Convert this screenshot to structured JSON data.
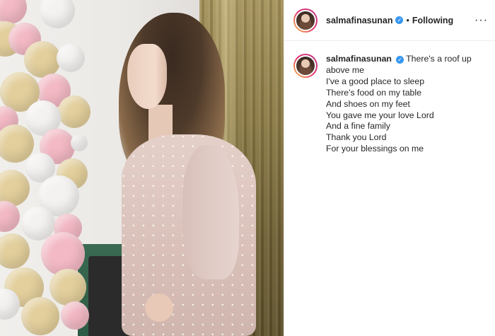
{
  "post": {
    "username": "salmafinasunan",
    "follow_status": "Following",
    "separator": "•",
    "more_icon": "···",
    "verified_icon": "✓"
  },
  "caption": {
    "first_line": "There's a roof up above me",
    "lines": [
      "I've a good place to sleep",
      "There's food on my table",
      "And shoes on my feet",
      "You gave me your love Lord",
      "And a fine family",
      "Thank you Lord",
      "For your blessings on me"
    ]
  },
  "colors": {
    "verified_blue": "#3897f0",
    "story_ring": [
      "#f9c54a",
      "#e1306c",
      "#c13584"
    ]
  }
}
